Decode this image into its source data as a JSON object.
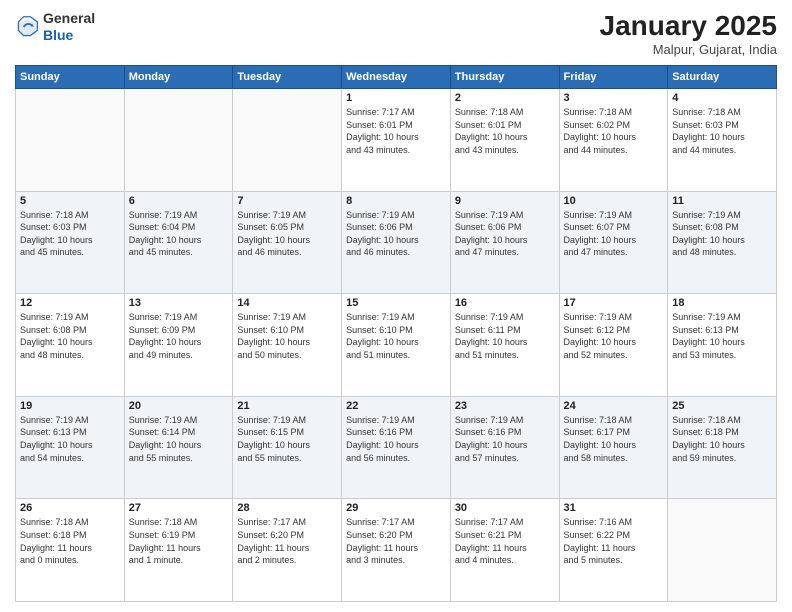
{
  "header": {
    "logo_general": "General",
    "logo_blue": "Blue",
    "month_title": "January 2025",
    "location": "Malpur, Gujarat, India"
  },
  "weekdays": [
    "Sunday",
    "Monday",
    "Tuesday",
    "Wednesday",
    "Thursday",
    "Friday",
    "Saturday"
  ],
  "weeks": [
    [
      {
        "day": "",
        "info": ""
      },
      {
        "day": "",
        "info": ""
      },
      {
        "day": "",
        "info": ""
      },
      {
        "day": "1",
        "info": "Sunrise: 7:17 AM\nSunset: 6:01 PM\nDaylight: 10 hours\nand 43 minutes."
      },
      {
        "day": "2",
        "info": "Sunrise: 7:18 AM\nSunset: 6:01 PM\nDaylight: 10 hours\nand 43 minutes."
      },
      {
        "day": "3",
        "info": "Sunrise: 7:18 AM\nSunset: 6:02 PM\nDaylight: 10 hours\nand 44 minutes."
      },
      {
        "day": "4",
        "info": "Sunrise: 7:18 AM\nSunset: 6:03 PM\nDaylight: 10 hours\nand 44 minutes."
      }
    ],
    [
      {
        "day": "5",
        "info": "Sunrise: 7:18 AM\nSunset: 6:03 PM\nDaylight: 10 hours\nand 45 minutes."
      },
      {
        "day": "6",
        "info": "Sunrise: 7:19 AM\nSunset: 6:04 PM\nDaylight: 10 hours\nand 45 minutes."
      },
      {
        "day": "7",
        "info": "Sunrise: 7:19 AM\nSunset: 6:05 PM\nDaylight: 10 hours\nand 46 minutes."
      },
      {
        "day": "8",
        "info": "Sunrise: 7:19 AM\nSunset: 6:06 PM\nDaylight: 10 hours\nand 46 minutes."
      },
      {
        "day": "9",
        "info": "Sunrise: 7:19 AM\nSunset: 6:06 PM\nDaylight: 10 hours\nand 47 minutes."
      },
      {
        "day": "10",
        "info": "Sunrise: 7:19 AM\nSunset: 6:07 PM\nDaylight: 10 hours\nand 47 minutes."
      },
      {
        "day": "11",
        "info": "Sunrise: 7:19 AM\nSunset: 6:08 PM\nDaylight: 10 hours\nand 48 minutes."
      }
    ],
    [
      {
        "day": "12",
        "info": "Sunrise: 7:19 AM\nSunset: 6:08 PM\nDaylight: 10 hours\nand 48 minutes."
      },
      {
        "day": "13",
        "info": "Sunrise: 7:19 AM\nSunset: 6:09 PM\nDaylight: 10 hours\nand 49 minutes."
      },
      {
        "day": "14",
        "info": "Sunrise: 7:19 AM\nSunset: 6:10 PM\nDaylight: 10 hours\nand 50 minutes."
      },
      {
        "day": "15",
        "info": "Sunrise: 7:19 AM\nSunset: 6:10 PM\nDaylight: 10 hours\nand 51 minutes."
      },
      {
        "day": "16",
        "info": "Sunrise: 7:19 AM\nSunset: 6:11 PM\nDaylight: 10 hours\nand 51 minutes."
      },
      {
        "day": "17",
        "info": "Sunrise: 7:19 AM\nSunset: 6:12 PM\nDaylight: 10 hours\nand 52 minutes."
      },
      {
        "day": "18",
        "info": "Sunrise: 7:19 AM\nSunset: 6:13 PM\nDaylight: 10 hours\nand 53 minutes."
      }
    ],
    [
      {
        "day": "19",
        "info": "Sunrise: 7:19 AM\nSunset: 6:13 PM\nDaylight: 10 hours\nand 54 minutes."
      },
      {
        "day": "20",
        "info": "Sunrise: 7:19 AM\nSunset: 6:14 PM\nDaylight: 10 hours\nand 55 minutes."
      },
      {
        "day": "21",
        "info": "Sunrise: 7:19 AM\nSunset: 6:15 PM\nDaylight: 10 hours\nand 55 minutes."
      },
      {
        "day": "22",
        "info": "Sunrise: 7:19 AM\nSunset: 6:16 PM\nDaylight: 10 hours\nand 56 minutes."
      },
      {
        "day": "23",
        "info": "Sunrise: 7:19 AM\nSunset: 6:16 PM\nDaylight: 10 hours\nand 57 minutes."
      },
      {
        "day": "24",
        "info": "Sunrise: 7:18 AM\nSunset: 6:17 PM\nDaylight: 10 hours\nand 58 minutes."
      },
      {
        "day": "25",
        "info": "Sunrise: 7:18 AM\nSunset: 6:18 PM\nDaylight: 10 hours\nand 59 minutes."
      }
    ],
    [
      {
        "day": "26",
        "info": "Sunrise: 7:18 AM\nSunset: 6:18 PM\nDaylight: 11 hours\nand 0 minutes."
      },
      {
        "day": "27",
        "info": "Sunrise: 7:18 AM\nSunset: 6:19 PM\nDaylight: 11 hours\nand 1 minute."
      },
      {
        "day": "28",
        "info": "Sunrise: 7:17 AM\nSunset: 6:20 PM\nDaylight: 11 hours\nand 2 minutes."
      },
      {
        "day": "29",
        "info": "Sunrise: 7:17 AM\nSunset: 6:20 PM\nDaylight: 11 hours\nand 3 minutes."
      },
      {
        "day": "30",
        "info": "Sunrise: 7:17 AM\nSunset: 6:21 PM\nDaylight: 11 hours\nand 4 minutes."
      },
      {
        "day": "31",
        "info": "Sunrise: 7:16 AM\nSunset: 6:22 PM\nDaylight: 11 hours\nand 5 minutes."
      },
      {
        "day": "",
        "info": ""
      }
    ]
  ]
}
